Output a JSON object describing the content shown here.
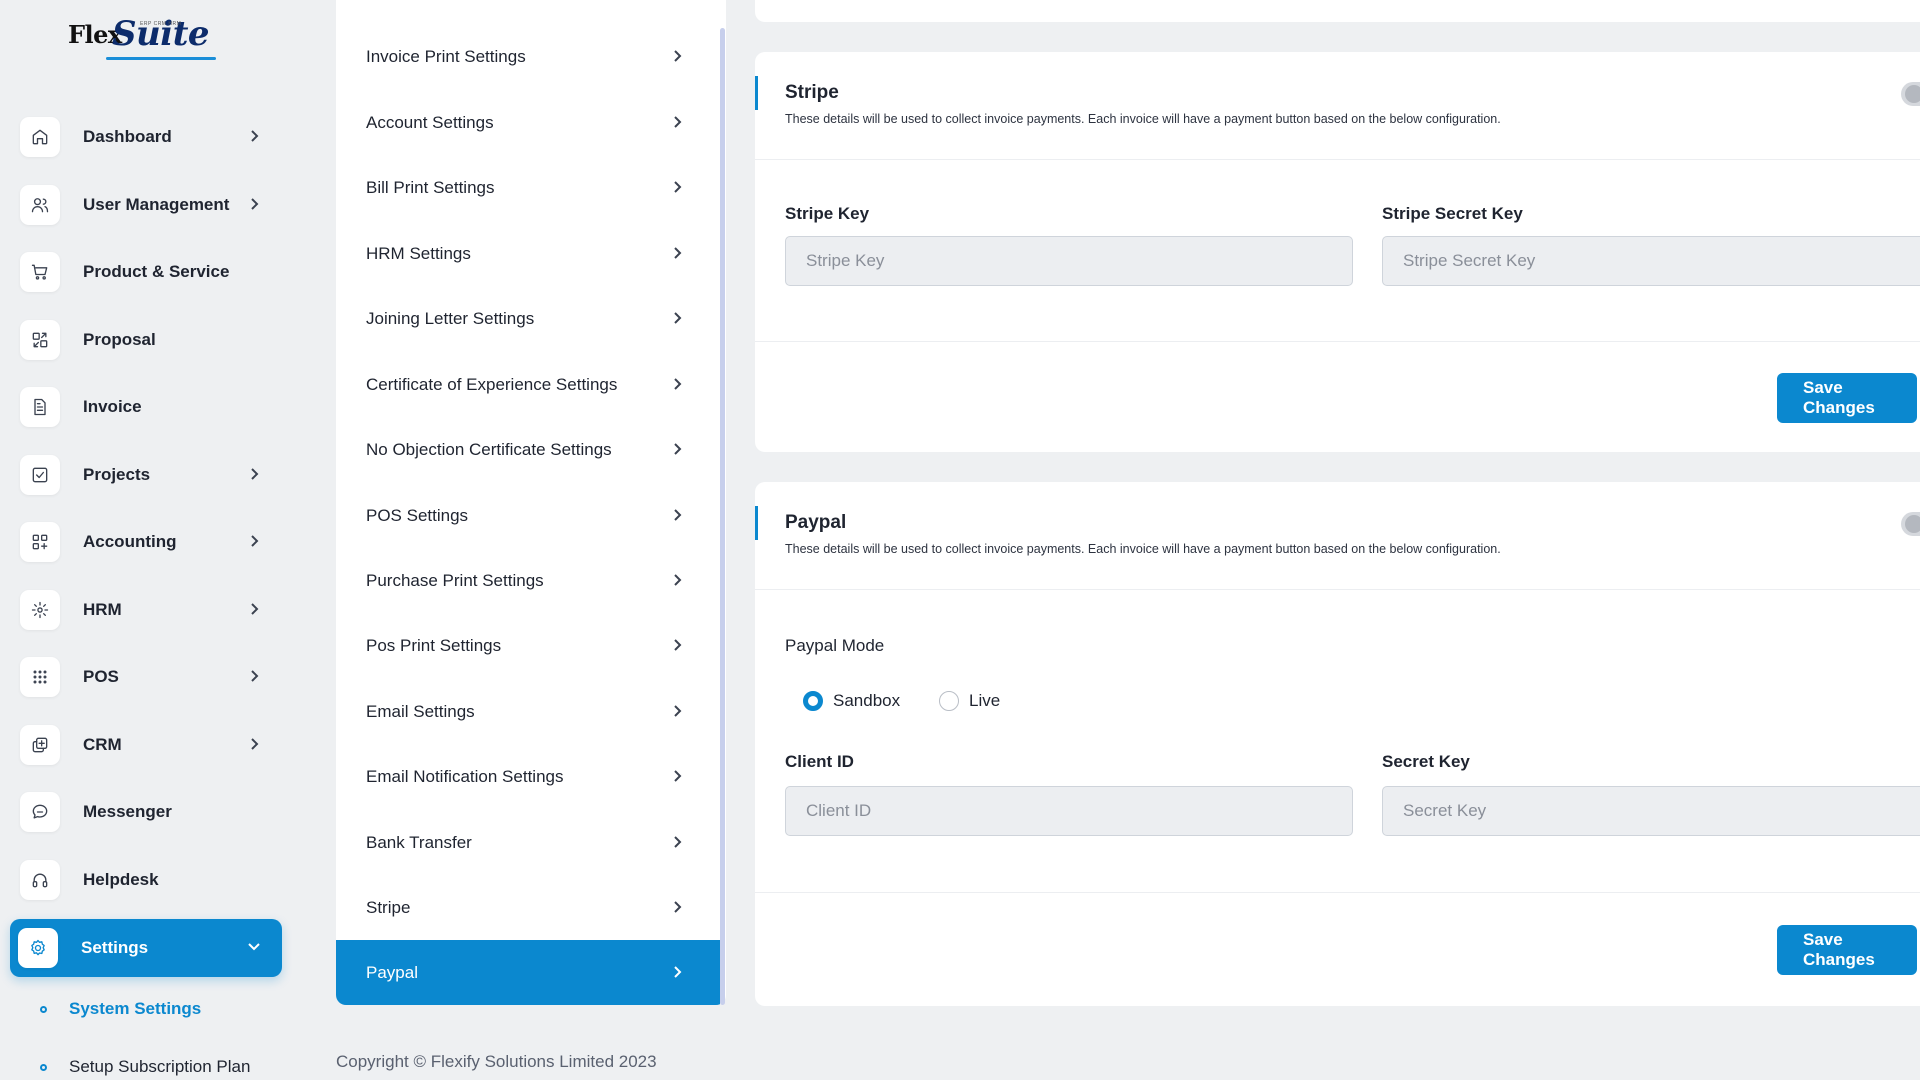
{
  "brand": {
    "name_part1": "Flex",
    "name_part2": "Suite",
    "tagline": "ERP CRM HRM"
  },
  "sidebar": {
    "items": [
      {
        "label": "Dashboard",
        "icon": "home-icon",
        "has_chevron": true
      },
      {
        "label": "User Management",
        "icon": "users-icon",
        "has_chevron": true
      },
      {
        "label": "Product & Service",
        "icon": "cart-icon",
        "has_chevron": false
      },
      {
        "label": "Proposal",
        "icon": "proposal-icon",
        "has_chevron": false
      },
      {
        "label": "Invoice",
        "icon": "file-icon",
        "has_chevron": false
      },
      {
        "label": "Projects",
        "icon": "checkbox-icon",
        "has_chevron": true
      },
      {
        "label": "Accounting",
        "icon": "grid-plus-icon",
        "has_chevron": true
      },
      {
        "label": "HRM",
        "icon": "hrm-icon",
        "has_chevron": true
      },
      {
        "label": "POS",
        "icon": "dots-grid-icon",
        "has_chevron": true
      },
      {
        "label": "CRM",
        "icon": "layers-icon",
        "has_chevron": true
      },
      {
        "label": "Messenger",
        "icon": "chat-icon",
        "has_chevron": false
      },
      {
        "label": "Helpdesk",
        "icon": "headset-icon",
        "has_chevron": false
      },
      {
        "label": "Settings",
        "icon": "gear-icon",
        "has_chevron": true,
        "active": true
      }
    ],
    "sub_items": [
      {
        "label": "System Settings",
        "active": true
      },
      {
        "label": "Setup Subscription Plan",
        "active": false
      }
    ]
  },
  "settings_menu": {
    "items": [
      {
        "label": "Invoice Print Settings"
      },
      {
        "label": "Account Settings"
      },
      {
        "label": "Bill Print Settings"
      },
      {
        "label": "HRM Settings"
      },
      {
        "label": "Joining Letter Settings"
      },
      {
        "label": "Certificate of Experience Settings"
      },
      {
        "label": "No Objection Certificate Settings"
      },
      {
        "label": "POS Settings"
      },
      {
        "label": "Purchase Print Settings"
      },
      {
        "label": "Pos Print Settings"
      },
      {
        "label": "Email Settings"
      },
      {
        "label": "Email Notification Settings"
      },
      {
        "label": "Bank Transfer"
      },
      {
        "label": "Stripe"
      },
      {
        "label": "Paypal",
        "active": true
      }
    ]
  },
  "stripe": {
    "title": "Stripe",
    "description": "These details will be used to collect invoice payments. Each invoice will have a payment button based on the below configuration.",
    "enabled": false,
    "key_label": "Stripe Key",
    "key_placeholder": "Stripe Key",
    "secret_label": "Stripe Secret Key",
    "secret_placeholder": "Stripe Secret Key",
    "save_label": "Save Changes"
  },
  "paypal": {
    "title": "Paypal",
    "description": "These details will be used to collect invoice payments. Each invoice will have a payment button based on the below configuration.",
    "enabled": false,
    "mode_label": "Paypal Mode",
    "modes": [
      {
        "label": "Sandbox",
        "checked": true
      },
      {
        "label": "Live",
        "checked": false
      }
    ],
    "client_label": "Client ID",
    "client_placeholder": "Client ID",
    "secret_label": "Secret Key",
    "secret_placeholder": "Secret Key",
    "save_label": "Save Changes"
  },
  "footer": {
    "copyright": "Copyright © Flexify Solutions Limited 2023"
  },
  "colors": {
    "accent": "#0b88cf",
    "background": "#eef0f2",
    "card": "#ffffff",
    "input_bg": "#eceef1"
  }
}
